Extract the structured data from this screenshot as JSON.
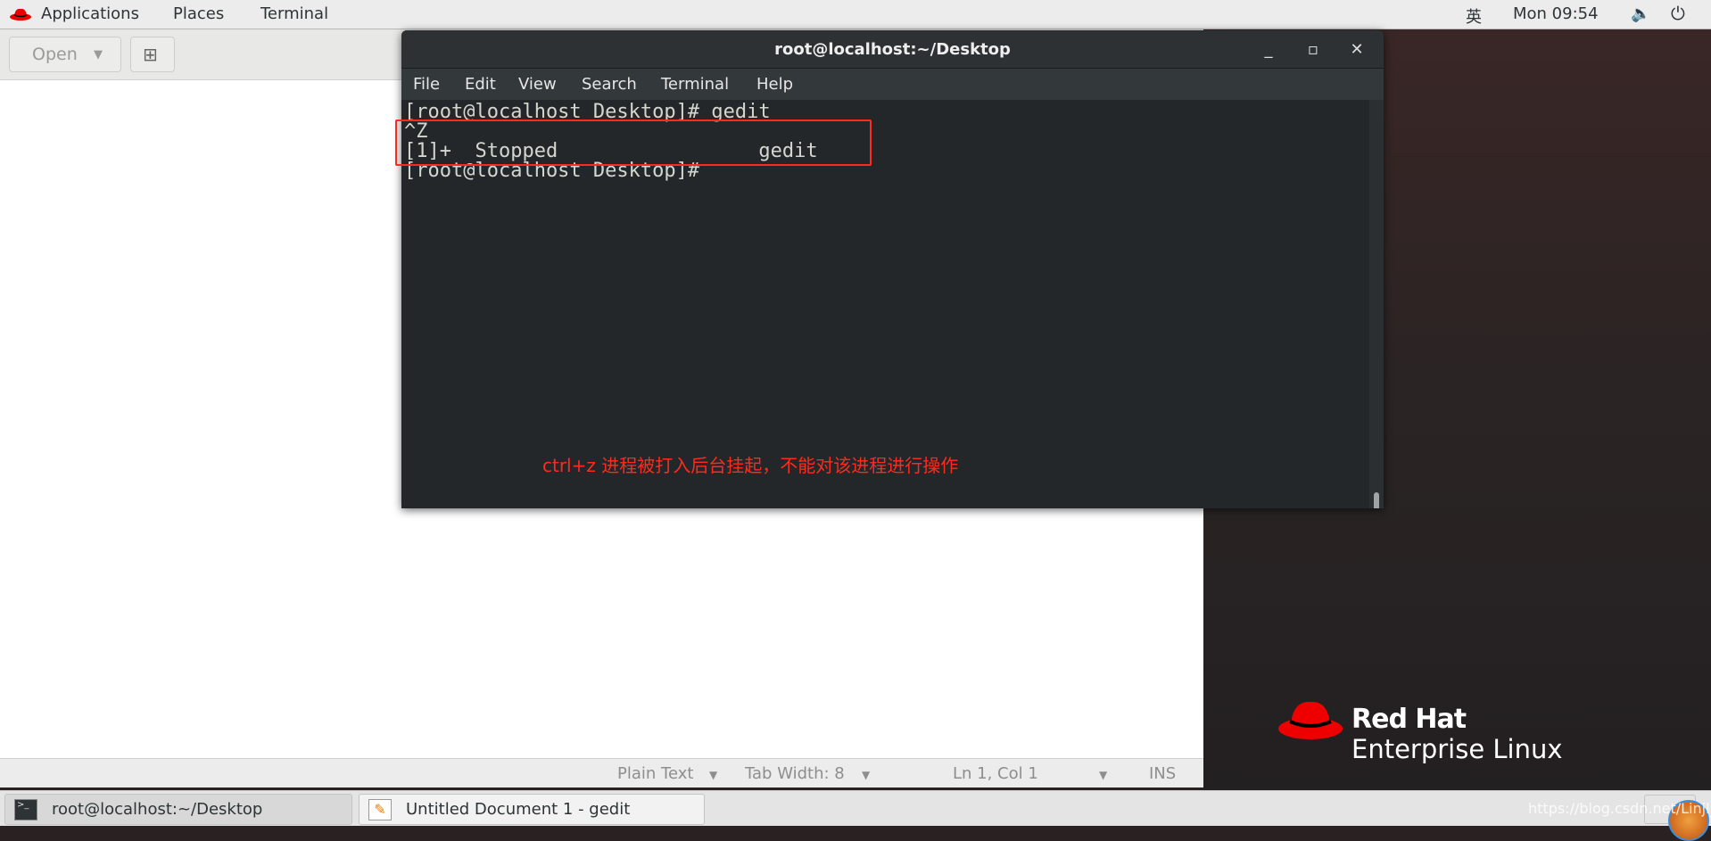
{
  "topbar": {
    "applications": "Applications",
    "places": "Places",
    "terminal": "Terminal",
    "input_method": "英",
    "clock": "Mon 09:54"
  },
  "gedit": {
    "open_label": "Open",
    "status": {
      "language": "Plain Text",
      "tab_width": "Tab Width: 8",
      "position": "Ln 1, Col 1",
      "mode": "INS"
    }
  },
  "terminal": {
    "title": "root@localhost:~/Desktop",
    "menu": [
      "File",
      "Edit",
      "View",
      "Search",
      "Terminal",
      "Help"
    ],
    "lines": [
      "[root@localhost Desktop]# gedit",
      "^Z",
      "[1]+  Stopped                 gedit",
      "[root@localhost Desktop]#"
    ]
  },
  "annotation": "ctrl+z 进程被打入后台挂起，不能对该进程进行操作",
  "desktop": {
    "logo_line1": "Red Hat",
    "logo_line2": "Enterprise Linux"
  },
  "taskbar": {
    "items": [
      "root@localhost:~/Desktop",
      "Untitled Document 1 - gedit"
    ]
  },
  "watermark": "https://blog.csdn.net/Linjl_G",
  "colors": {
    "annotation": "#ff2a1e",
    "redhat": "#ee0000",
    "terminal_bg": "#232729"
  }
}
